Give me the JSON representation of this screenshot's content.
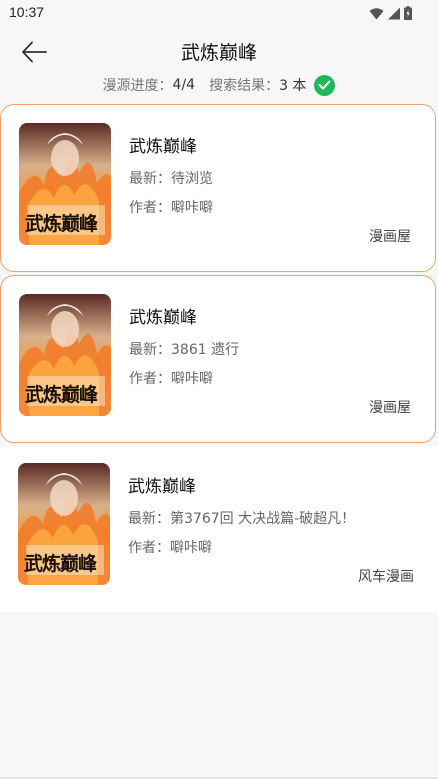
{
  "status_bar": {
    "time": "10:37"
  },
  "header": {
    "title": "武炼巅峰"
  },
  "progress": {
    "source_label": "漫源进度：",
    "source_value": "4/4",
    "result_label": "搜索结果：",
    "result_value": "3 本"
  },
  "results": [
    {
      "title": "武炼巅峰",
      "latest_label": "最新：",
      "latest_value": "待浏览",
      "author_label": "作者：",
      "author_value": "噼咔噼",
      "source": "漫画屋",
      "cover_caption": "武炼巅峰"
    },
    {
      "title": "武炼巅峰",
      "latest_label": "最新：",
      "latest_value": "3861 遗行",
      "author_label": "作者：",
      "author_value": "噼咔噼",
      "source": "漫画屋",
      "cover_caption": "武炼巅峰"
    },
    {
      "title": "武炼巅峰",
      "latest_label": "最新：",
      "latest_value": "第3767回 大决战篇-破超凡！",
      "author_label": "作者：",
      "author_value": "噼咔噼",
      "source": "风车漫画",
      "cover_caption": "武炼巅峰"
    }
  ],
  "colors": {
    "accent_border": "#f0a068",
    "check_green": "#1fb75a",
    "background": "#f7f7f7"
  },
  "icons": {
    "back": "arrow-left-icon",
    "check": "check-circle-icon",
    "wifi": "wifi-icon",
    "signal": "signal-icon",
    "battery": "battery-icon"
  }
}
